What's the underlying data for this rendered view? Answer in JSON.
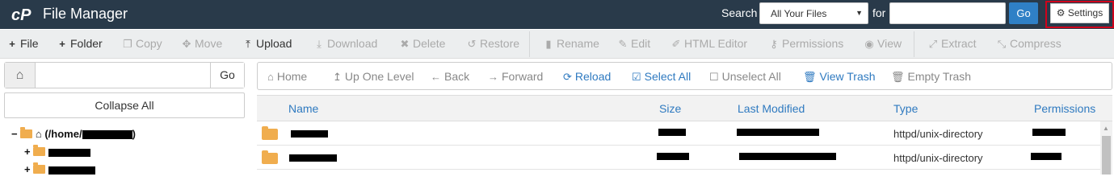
{
  "header": {
    "app_title": "File Manager",
    "search_label": "Search",
    "search_scope": "All Your Files",
    "for_label": "for",
    "search_value": "",
    "go_label": "Go",
    "settings_label": "Settings",
    "highlight_color": "#d0021b",
    "bar_color": "#293a4a"
  },
  "toolbar": {
    "file": "File",
    "folder": "Folder",
    "copy": "Copy",
    "move": "Move",
    "upload": "Upload",
    "download": "Download",
    "delete": "Delete",
    "restore": "Restore",
    "rename": "Rename",
    "edit": "Edit",
    "html_editor": "HTML Editor",
    "permissions": "Permissions",
    "view": "View",
    "extract": "Extract",
    "compress": "Compress"
  },
  "tree": {
    "path_value": "",
    "go_label": "Go",
    "collapse_label": "Collapse All",
    "root_label": "(/home/",
    "root_suffix": ")"
  },
  "nav": {
    "home": "Home",
    "up_one_level": "Up One Level",
    "back": "Back",
    "forward": "Forward",
    "reload": "Reload",
    "select_all": "Select All",
    "unselect_all": "Unselect All",
    "view_trash": "View Trash",
    "empty_trash": "Empty Trash"
  },
  "table": {
    "columns": [
      "Name",
      "Size",
      "Last Modified",
      "Type",
      "Permissions"
    ],
    "rows": [
      {
        "type": "httpd/unix-directory"
      },
      {
        "type": "httpd/unix-directory"
      }
    ]
  },
  "colors": {
    "link_blue": "#2f7ac0",
    "folder": "#f0ad4e",
    "go_button": "#2f80c6"
  }
}
